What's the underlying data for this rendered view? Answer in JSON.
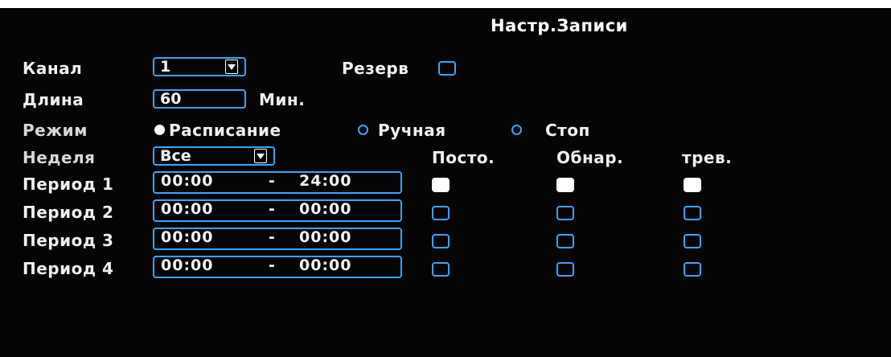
{
  "title": "Настр.Записи",
  "channel": {
    "label": "Канал",
    "value": "1"
  },
  "reserve": {
    "label": "Резерв",
    "checked": false
  },
  "length": {
    "label": "Длина",
    "value": "60",
    "unit": "Мин."
  },
  "mode": {
    "label": "Режим",
    "options": [
      "Расписание",
      "Ручная",
      "Стоп"
    ],
    "selected": "Расписание"
  },
  "week": {
    "label": "Неделя",
    "value": "Все"
  },
  "columns": [
    "Посто.",
    "Обнар.",
    "трев."
  ],
  "periods": [
    {
      "label": "Период 1",
      "start": "00:00",
      "sep": "-",
      "end": "24:00",
      "flags": [
        true,
        true,
        true
      ]
    },
    {
      "label": "Период 2",
      "start": "00:00",
      "sep": "-",
      "end": "00:00",
      "flags": [
        false,
        false,
        false
      ]
    },
    {
      "label": "Период 3",
      "start": "00:00",
      "sep": "-",
      "end": "00:00",
      "flags": [
        false,
        false,
        false
      ]
    },
    {
      "label": "Период 4",
      "start": "00:00",
      "sep": "-",
      "end": "00:00",
      "flags": [
        false,
        false,
        false
      ]
    }
  ],
  "colors": {
    "accent": "#3aa4ff",
    "background": "#050505",
    "text": "#f2f2f2"
  }
}
